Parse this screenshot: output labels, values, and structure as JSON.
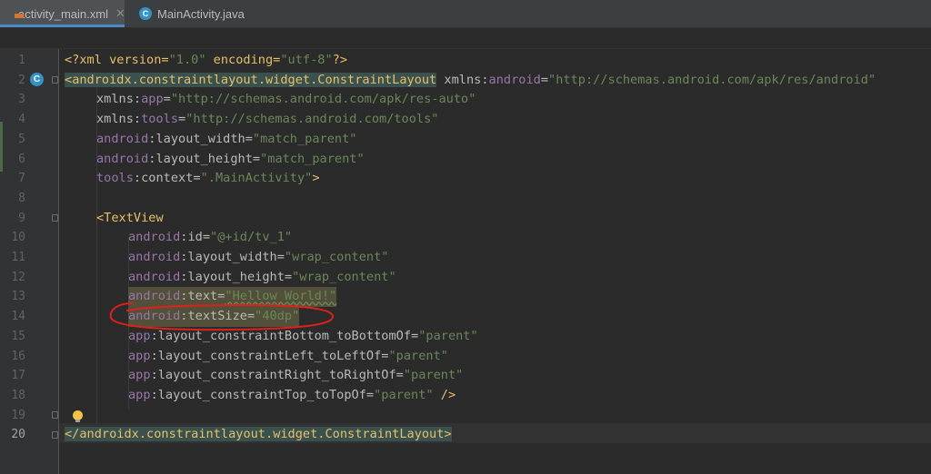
{
  "tabs": [
    {
      "label": "activity_main.xml",
      "icon": "xml-file-icon",
      "active": true
    },
    {
      "label": "MainActivity.java",
      "icon": "java-class-icon",
      "active": false
    }
  ],
  "gutter": {
    "line_numbers": [
      "1",
      "2",
      "3",
      "4",
      "5",
      "6",
      "7",
      "8",
      "9",
      "10",
      "11",
      "12",
      "13",
      "14",
      "15",
      "16",
      "17",
      "18",
      "19",
      "20"
    ],
    "badge_glyph": "C"
  },
  "code": {
    "l1": {
      "a": "<?xml version=",
      "b": "\"1.0\"",
      "c": " encoding=",
      "d": "\"utf-8\"",
      "e": "?>"
    },
    "l2": {
      "open": "<",
      "tag_a": "androidx",
      "dot1": ".",
      "tag_b": "constraintlayout",
      "dot2": ".",
      "tag_c": "widget",
      "dot3": ".",
      "tag_d": "ConstraintLayout",
      "ns": " xmlns",
      "colon": ":",
      "attr": "android",
      "eq": "=",
      "val": "\"http://schemas.android.com/apk/res/android\""
    },
    "l3": {
      "ns": "xmlns",
      "colon": ":",
      "attr": "app",
      "eq": "=",
      "val": "\"http://schemas.android.com/apk/res-auto\""
    },
    "l4": {
      "ns": "xmlns",
      "colon": ":",
      "attr": "tools",
      "eq": "=",
      "val": "\"http://schemas.android.com/tools\""
    },
    "l5": {
      "ns": "android",
      "colon": ":",
      "attr": "layout_width",
      "eq": "=",
      "val": "\"match_parent\""
    },
    "l6": {
      "ns": "android",
      "colon": ":",
      "attr": "layout_height",
      "eq": "=",
      "val": "\"match_parent\""
    },
    "l7": {
      "ns": "tools",
      "colon": ":",
      "attr": "context",
      "eq": "=",
      "val": "\".MainActivity\"",
      "close": ">"
    },
    "l9": {
      "tag": "<TextView"
    },
    "l10": {
      "ns": "android",
      "colon": ":",
      "attr": "id",
      "eq": "=",
      "val": "\"@+id/tv_1\""
    },
    "l11": {
      "ns": "android",
      "colon": ":",
      "attr": "layout_width",
      "eq": "=",
      "val": "\"wrap_content\""
    },
    "l12": {
      "ns": "android",
      "colon": ":",
      "attr": "layout_height",
      "eq": "=",
      "val": "\"wrap_content\""
    },
    "l13": {
      "ns": "android",
      "colon": ":",
      "attr": "text",
      "eq": "=",
      "val": "\"Hellow World!\""
    },
    "l14": {
      "ns": "android",
      "colon": ":",
      "attr": "textSize",
      "eq": "=",
      "val": "\"40dp\""
    },
    "l15": {
      "ns": "app",
      "colon": ":",
      "attr": "layout_constraintBottom_toBottomOf",
      "eq": "=",
      "val": "\"parent\""
    },
    "l16": {
      "ns": "app",
      "colon": ":",
      "attr": "layout_constraintLeft_toLeftOf",
      "eq": "=",
      "val": "\"parent\""
    },
    "l17": {
      "ns": "app",
      "colon": ":",
      "attr": "layout_constraintRight_toRightOf",
      "eq": "=",
      "val": "\"parent\""
    },
    "l18": {
      "ns": "app",
      "colon": ":",
      "attr": "layout_constraintTop_toTopOf",
      "eq": "=",
      "val": "\"parent\"",
      "close": " />"
    },
    "l20": {
      "open": "</",
      "tag_a": "androidx",
      "dot1": ".",
      "tag_b": "constraintlayout",
      "dot2": ".",
      "tag_c": "widget",
      "dot3": ".",
      "tag_d": "ConstraintLayout",
      "close": ">"
    }
  },
  "colors": {
    "background": "#2b2b2b",
    "tag": "#e8bf6a",
    "namespace": "#9876aa",
    "string": "#6a8759",
    "annotation": "#e0201a"
  }
}
